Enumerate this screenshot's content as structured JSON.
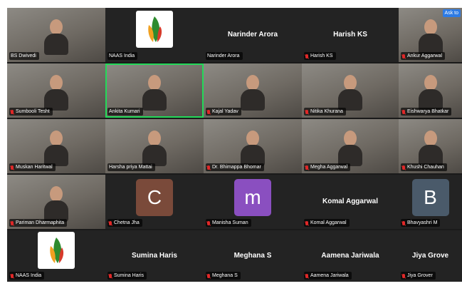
{
  "meeting": {
    "ask_button": "Ask to",
    "colors": {
      "active_speaker": "#23d959",
      "muted_mic": "#e02828",
      "tile_bg": "#232323",
      "button": "#2d7be5"
    },
    "participants": [
      {
        "name": "BS Dwivedi",
        "label": "",
        "kind": "video"
      },
      {
        "name": "NAAS India",
        "label": "",
        "kind": "logo"
      },
      {
        "name": "Narinder Arora",
        "label": "Narinder Arora",
        "kind": "name"
      },
      {
        "name": "Harish KS",
        "label": "Harish KS",
        "kind": "name"
      },
      {
        "name": "Ankur Aggarwal",
        "label": "",
        "kind": "video"
      },
      {
        "name": "Sumbooli Tesht",
        "label": "",
        "kind": "video"
      },
      {
        "name": "Ankita Kumari",
        "label": "",
        "kind": "video"
      },
      {
        "name": "Kajal Yadav",
        "label": "",
        "kind": "video"
      },
      {
        "name": "Nitika Khurana",
        "label": "",
        "kind": "video"
      },
      {
        "name": "Eishwarya Bhatkar",
        "label": "",
        "kind": "video"
      },
      {
        "name": "Muskan Haritwal",
        "label": "",
        "kind": "video"
      },
      {
        "name": "Harsha priya Mattai",
        "label": "",
        "kind": "video"
      },
      {
        "name": "Dr. Bhimappa Bhomar",
        "label": "",
        "kind": "video"
      },
      {
        "name": "Megha Aggarwal",
        "label": "",
        "kind": "video"
      },
      {
        "name": "Khushi Chauhan",
        "label": "",
        "kind": "video"
      },
      {
        "name": "Pariman Dharmaphita",
        "label": "",
        "kind": "video"
      },
      {
        "name": "Chetna Jha",
        "label": "C",
        "kind": "avatar"
      },
      {
        "name": "Manisha Suman",
        "label": "m",
        "kind": "avatar"
      },
      {
        "name": "Komal Aggarwal",
        "label": "Komal Aggarwal",
        "kind": "name"
      },
      {
        "name": "Bhavyashri M",
        "label": "B",
        "kind": "avatar"
      },
      {
        "name": "NAAS India",
        "label": "",
        "kind": "logo"
      },
      {
        "name": "Sumina Haris",
        "label": "Sumina Haris",
        "kind": "name"
      },
      {
        "name": "Meghana S",
        "label": "Meghana S",
        "kind": "name"
      },
      {
        "name": "Aamena Jariwala",
        "label": "Aamena Jariwala",
        "kind": "name"
      },
      {
        "name": "Jiya Grover",
        "label": "Jiya Grove",
        "kind": "name"
      }
    ]
  }
}
